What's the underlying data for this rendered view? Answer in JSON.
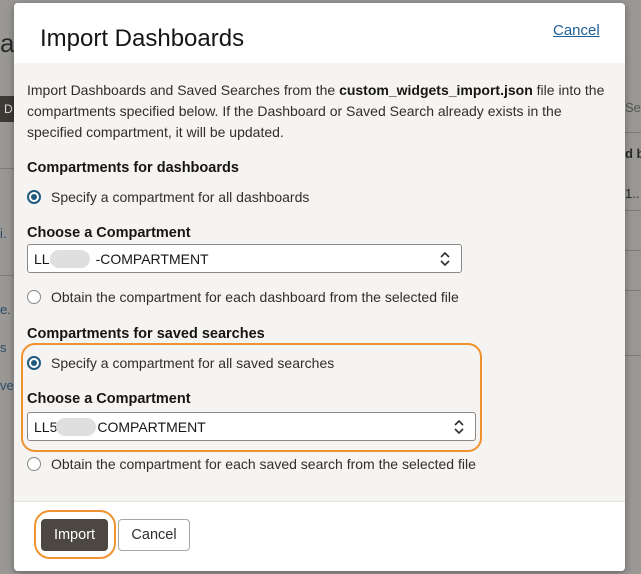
{
  "background": {
    "title_fragment": "ab",
    "tab_fragment": "D",
    "left_fragments": [
      "i.",
      "e.",
      "s",
      "ve"
    ],
    "right_fragments": [
      "Se",
      "d b",
      "1.."
    ]
  },
  "dialog": {
    "title": "Import Dashboards",
    "cancel_link": "Cancel",
    "intro_prefix": "Import Dashboards and Saved Searches from the ",
    "intro_filename": "custom_widgets_import.json",
    "intro_suffix": " file into the compartments specified below. If the Dashboard or Saved Search already exists in the specified compartment, it will be updated.",
    "dashboards": {
      "heading": "Compartments for dashboards",
      "option_all": "Specify a compartment for all dashboards",
      "choose_label": "Choose a Compartment",
      "selected_prefix": "LL",
      "selected_suffix": "-COMPARTMENT",
      "option_file": "Obtain the compartment for each dashboard from the selected file"
    },
    "saved_searches": {
      "heading": "Compartments for saved searches",
      "option_all": "Specify a compartment for all saved searches",
      "choose_label": "Choose a Compartment",
      "selected_prefix": "LL5",
      "selected_suffix": "COMPARTMENT",
      "option_file": "Obtain the compartment for each saved search from the selected file"
    },
    "footer": {
      "import_button": "Import",
      "cancel_button": "Cancel"
    },
    "highlight_color": "#f0922f",
    "primary_button_color": "#4d4741",
    "radio_selected_color": "#205a80",
    "link_color": "#1e5f97"
  }
}
